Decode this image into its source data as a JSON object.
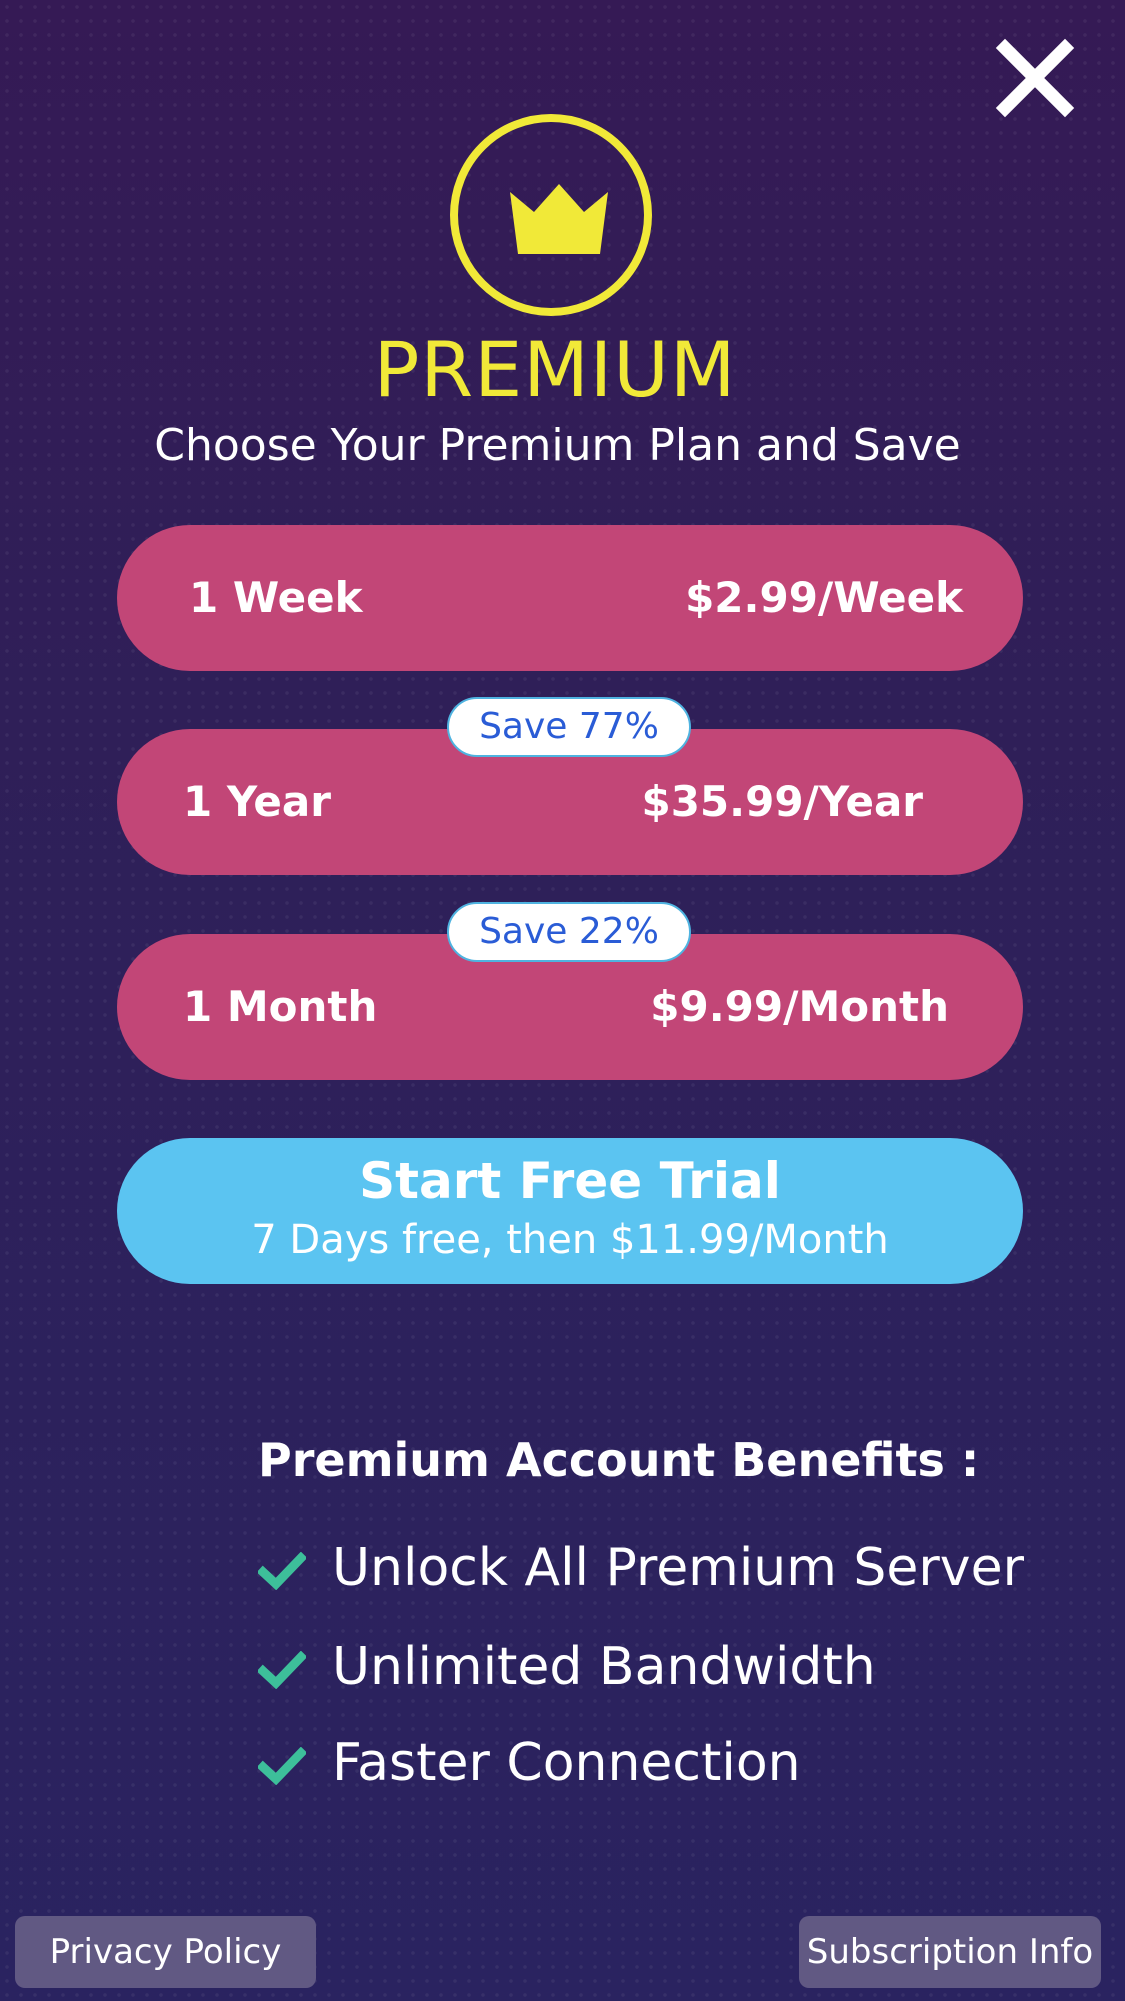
{
  "header": {
    "close_icon": "close-icon"
  },
  "badge": {
    "icon": "crown-icon",
    "color": "#f1e938"
  },
  "title": "PREMIUM",
  "subtitle": "Choose Your Premium Plan and Save",
  "plans": [
    {
      "name": "1 Week",
      "price": "$2.99/Week",
      "save": ""
    },
    {
      "name": "1 Year",
      "price": "$35.99/Year",
      "save": "Save 77%"
    },
    {
      "name": "1 Month",
      "price": "$9.99/Month",
      "save": "Save 22%"
    }
  ],
  "trial": {
    "title": "Start Free Trial",
    "subtitle": "7 Days free, then $11.99/Month"
  },
  "benefits": {
    "heading": "Premium Account Benefits :",
    "check_icon": "check-icon",
    "items": [
      "Unlock All Premium Server",
      "Unlimited Bandwidth",
      "Faster Connection"
    ]
  },
  "footer": {
    "privacy_label": "Privacy Policy",
    "subscription_label": "Subscription Info"
  },
  "colors": {
    "background": "#2d2158",
    "accent_yellow": "#f1e938",
    "plan_pink": "#c24677",
    "trial_blue": "#5bc4f1",
    "badge_text_blue": "#2a5cd6",
    "check_green": "#3dbf9a",
    "footer_button": "#615983"
  }
}
